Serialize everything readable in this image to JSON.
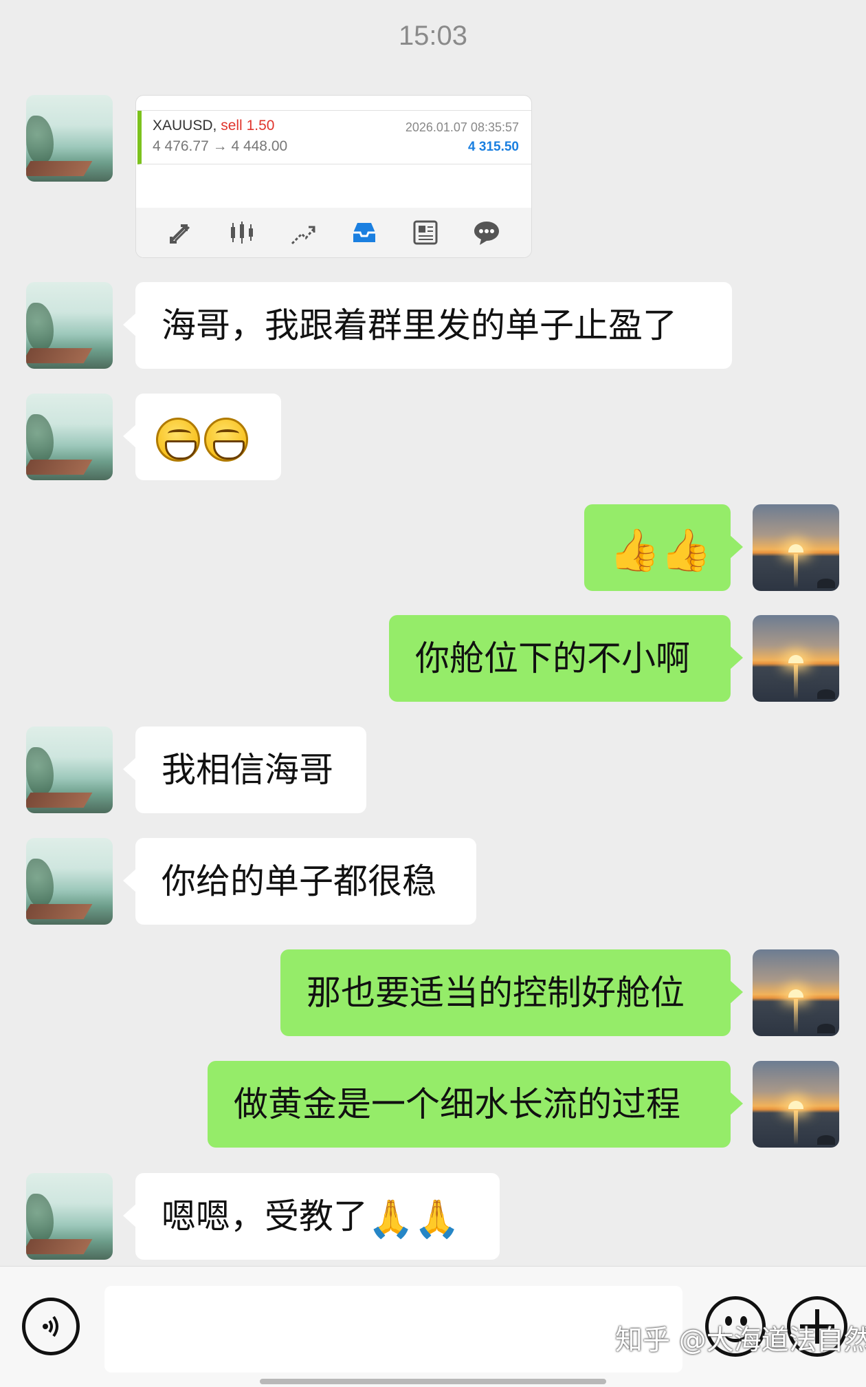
{
  "status": {
    "time": "15:03"
  },
  "trade_card": {
    "symbol": "XAUUSD,",
    "side": "sell",
    "volume": "1.50",
    "open_price": "4 476.77",
    "arrow": "→",
    "close_price": "4 448.00",
    "date": "2026.01.07 08:35:57",
    "profit": "4 315.50",
    "accent_color": "#7cc21d",
    "profit_color": "#1a7fe0",
    "toolbar_icons": [
      "quotes-icon",
      "chart-candles-icon",
      "trade-icon",
      "history-inbox-icon",
      "news-icon",
      "chat-icon"
    ]
  },
  "messages": [
    {
      "from": "friend",
      "text": "海哥，我跟着群里发的单子止盈了"
    },
    {
      "from": "friend",
      "text": "",
      "emoji": "grinning-face-icon"
    },
    {
      "from": "me",
      "text": "",
      "emoji": "thumbs-up-icon"
    },
    {
      "from": "me",
      "text": "你舱位下的不小啊"
    },
    {
      "from": "friend",
      "text": "我相信海哥"
    },
    {
      "from": "friend",
      "text": "你给的单子都很稳"
    },
    {
      "from": "me",
      "text": "那也要适当的控制好舱位"
    },
    {
      "from": "me",
      "text": "做黄金是一个细水长流的过程"
    },
    {
      "from": "friend",
      "text": "嗯嗯，受教了",
      "emoji": "folded-hands-icon"
    }
  ],
  "bubble_colors": {
    "incoming": "#ffffff",
    "outgoing": "#95ec69"
  },
  "input_bar": {
    "value": ""
  },
  "watermark": "知乎 @大海道法自然"
}
